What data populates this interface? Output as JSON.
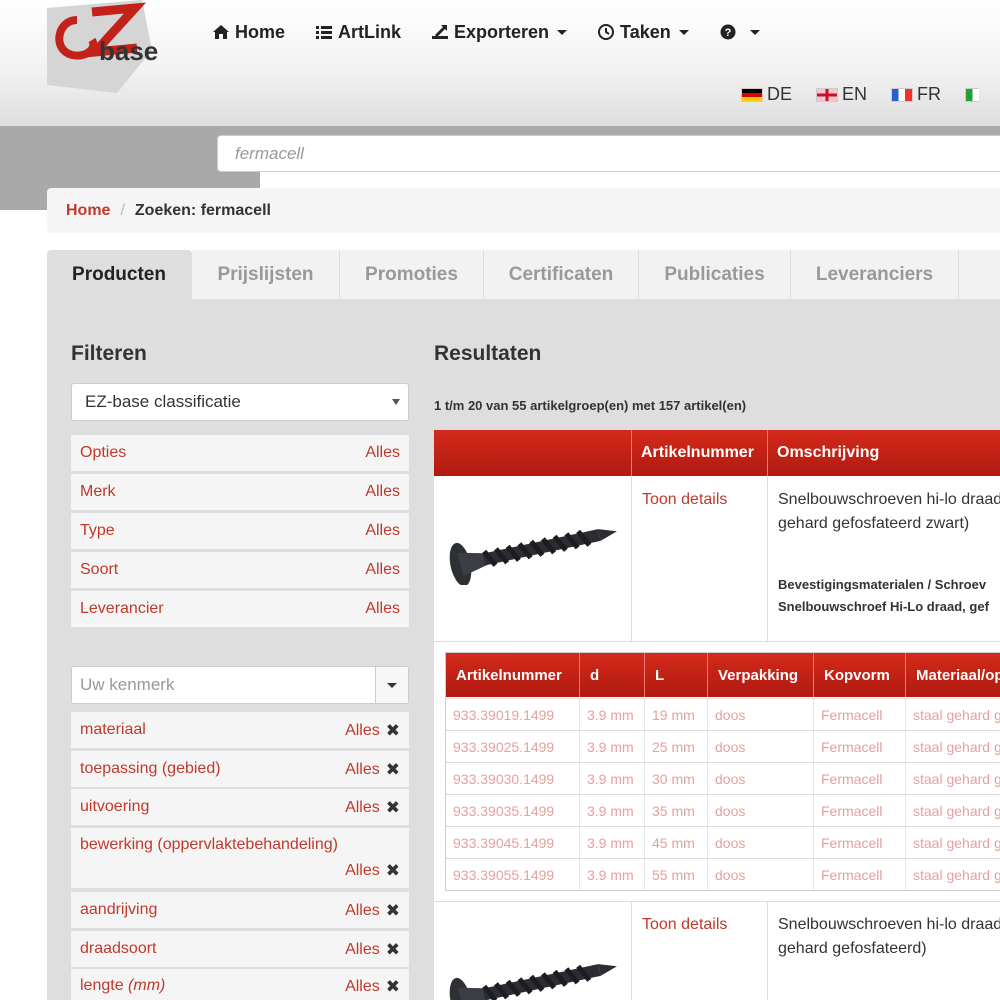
{
  "header": {
    "logo_text": "base",
    "nav": [
      {
        "label": "Home",
        "icon": "home-icon"
      },
      {
        "label": "ArtLink",
        "icon": "list-icon"
      },
      {
        "label": "Exporteren",
        "icon": "export-icon"
      },
      {
        "label": "Taken",
        "icon": "clock-icon"
      },
      {
        "label": "",
        "icon": "help-icon"
      }
    ],
    "languages": [
      "DE",
      "EN",
      "FR"
    ]
  },
  "search": {
    "placeholder": "fermacell"
  },
  "breadcrumb": {
    "home": "Home",
    "separator": "/",
    "current": "Zoeken: fermacell"
  },
  "tabs": [
    "Producten",
    "Prijslijsten",
    "Promoties",
    "Certificaten",
    "Publicaties",
    "Leveranciers"
  ],
  "filters": {
    "title": "Filteren",
    "classification": "EZ-base classificatie",
    "rows": [
      {
        "label": "Opties",
        "value": "Alles"
      },
      {
        "label": "Merk",
        "value": "Alles"
      },
      {
        "label": "Type",
        "value": "Alles"
      },
      {
        "label": "Soort",
        "value": "Alles"
      },
      {
        "label": "Leverancier",
        "value": "Alles"
      }
    ],
    "kenmerk_placeholder": "Uw kenmerk",
    "kenmerken": [
      {
        "label": "materiaal",
        "value": "Alles"
      },
      {
        "label": "toepassing (gebied)",
        "value": "Alles"
      },
      {
        "label": "uitvoering",
        "value": "Alles"
      },
      {
        "label": "bewerking (oppervlaktebehandeling)",
        "value": "Alles"
      },
      {
        "label": "aandrijving",
        "value": "Alles"
      },
      {
        "label": "draadsoort",
        "value": "Alles"
      },
      {
        "label": "lengte",
        "unit": "(mm)",
        "value": "Alles"
      }
    ]
  },
  "results": {
    "title": "Resultaten",
    "count": "1 t/m 20 van 55 artikelgroep(en) met 157 artikel(en)",
    "columns": [
      "Artikelnummer",
      "Omschrijving"
    ],
    "groups": [
      {
        "details_link": "Toon details",
        "desc_line1": "Snelbouwschroeven hi-lo draad",
        "desc_line2": "gehard gefosfateerd zwart)",
        "class_line1": "Bevestigingsmaterialen / Schroev",
        "class_line2": "Snelbouwschroef Hi-Lo draad, gef"
      },
      {
        "details_link": "Toon details",
        "desc_line1": "Snelbouwschroeven hi-lo draad",
        "desc_line2": "gehard gefosfateerd)"
      }
    ],
    "sub_columns": [
      "Artikelnummer",
      "d",
      "L",
      "Verpakking",
      "Kopvorm",
      "Materiaal/op"
    ],
    "sub_rows": [
      [
        "933.39019.1499",
        "3.9 mm",
        "19 mm",
        "doos",
        "Fermacell",
        "staal gehard g"
      ],
      [
        "933.39025.1499",
        "3.9 mm",
        "25 mm",
        "doos",
        "Fermacell",
        "staal gehard g"
      ],
      [
        "933.39030.1499",
        "3.9 mm",
        "30 mm",
        "doos",
        "Fermacell",
        "staal gehard g"
      ],
      [
        "933.39035.1499",
        "3.9 mm",
        "35 mm",
        "doos",
        "Fermacell",
        "staal gehard g"
      ],
      [
        "933.39045.1499",
        "3.9 mm",
        "45 mm",
        "doos",
        "Fermacell",
        "staal gehard g"
      ],
      [
        "933.39055.1499",
        "3.9 mm",
        "55 mm",
        "doos",
        "Fermacell",
        "staal gehard g"
      ]
    ]
  },
  "colors": {
    "accent": "#c0392b",
    "header_red": "#c3221a"
  }
}
